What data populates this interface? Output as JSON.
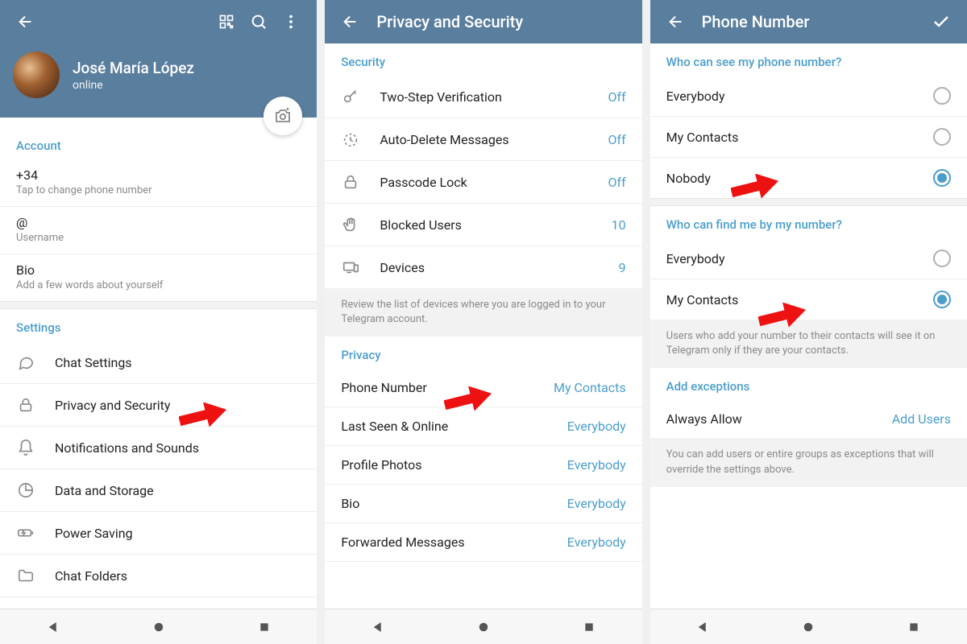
{
  "icons": {
    "back": "arrow-left",
    "qr": "qr-code",
    "search": "search",
    "more": "more-vertical",
    "check": "check",
    "camera": "camera-plus"
  },
  "screen1": {
    "profile": {
      "name": "José María López",
      "status": "online"
    },
    "account_section": "Account",
    "phone": {
      "value": "+34",
      "hint": "Tap to change phone number"
    },
    "username": {
      "value": "@",
      "hint": "Username"
    },
    "bio": {
      "value": "Bio",
      "hint": "Add a few words about yourself"
    },
    "settings_section": "Settings",
    "settings": [
      {
        "label": "Chat Settings",
        "icon": "chat"
      },
      {
        "label": "Privacy and Security",
        "icon": "lock"
      },
      {
        "label": "Notifications and Sounds",
        "icon": "bell"
      },
      {
        "label": "Data and Storage",
        "icon": "pie"
      },
      {
        "label": "Power Saving",
        "icon": "battery"
      },
      {
        "label": "Chat Folders",
        "icon": "folder"
      }
    ]
  },
  "screen2": {
    "title": "Privacy and Security",
    "security_section": "Security",
    "security": [
      {
        "label": "Two-Step Verification",
        "value": "Off",
        "icon": "key"
      },
      {
        "label": "Auto-Delete Messages",
        "value": "Off",
        "icon": "timer"
      },
      {
        "label": "Passcode Lock",
        "value": "Off",
        "icon": "lock"
      },
      {
        "label": "Blocked Users",
        "value": "10",
        "icon": "hand"
      },
      {
        "label": "Devices",
        "value": "9",
        "icon": "devices"
      }
    ],
    "devices_hint": "Review the list of devices where you are logged in to your Telegram account.",
    "privacy_section": "Privacy",
    "privacy": [
      {
        "label": "Phone Number",
        "value": "My Contacts"
      },
      {
        "label": "Last Seen & Online",
        "value": "Everybody"
      },
      {
        "label": "Profile Photos",
        "value": "Everybody"
      },
      {
        "label": "Bio",
        "value": "Everybody"
      },
      {
        "label": "Forwarded Messages",
        "value": "Everybody"
      }
    ]
  },
  "screen3": {
    "title": "Phone Number",
    "q1": "Who can see my phone number?",
    "q1_options": [
      {
        "label": "Everybody",
        "selected": false
      },
      {
        "label": "My Contacts",
        "selected": false
      },
      {
        "label": "Nobody",
        "selected": true
      }
    ],
    "q2": "Who can find me by my number?",
    "q2_options": [
      {
        "label": "Everybody",
        "selected": false
      },
      {
        "label": "My Contacts",
        "selected": true
      }
    ],
    "q2_hint": "Users who add your number to their contacts will see it on Telegram only if they are your contacts.",
    "exceptions_section": "Add exceptions",
    "always_allow": "Always Allow",
    "add_users": "Add Users",
    "exceptions_hint": "You can add users or entire groups as exceptions that will override the settings above."
  }
}
